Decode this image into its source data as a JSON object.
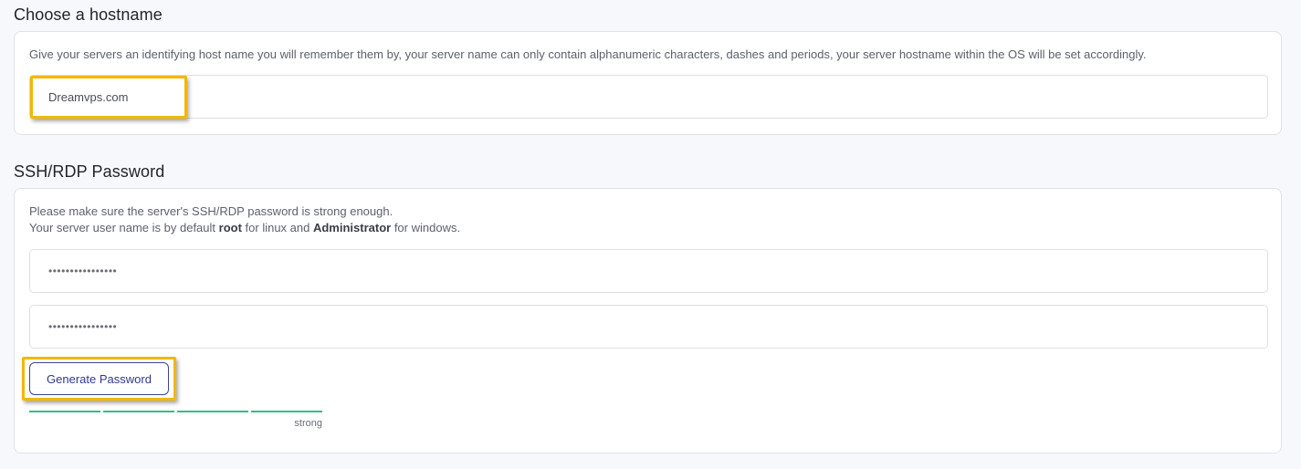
{
  "hostname_section": {
    "title": "Choose a hostname",
    "description": "Give your servers an identifying host name you will remember them by, your server name can only contain alphanumeric characters, dashes and periods, your server hostname within the OS will be set accordingly.",
    "input_value": "Dreamvps.com"
  },
  "password_section": {
    "title": "SSH/RDP Password",
    "description_line1": "Please make sure the server's SSH/RDP password is strong enough.",
    "description_line2_prefix": "Your server user name is by default ",
    "linux_user": "root",
    "description_line2_mid": " for linux and ",
    "windows_user": "Administrator",
    "description_line2_suffix": " for windows.",
    "password_value": "••••••••••••••••",
    "confirm_value": "••••••••••••••••",
    "generate_button_label": "Generate Password",
    "strength_label": "strong",
    "strength_segments_filled": 4,
    "strength_segments_total": 4
  },
  "colors": {
    "highlight": "#f2b705",
    "strength_bar": "#2fbf85",
    "button_border": "#3d4591"
  }
}
